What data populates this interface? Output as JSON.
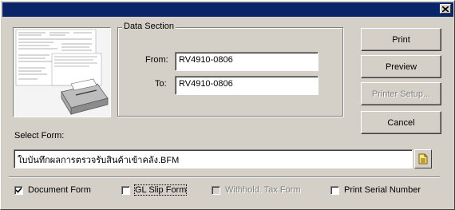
{
  "window": {
    "title": ""
  },
  "data_section": {
    "title": "Data Section",
    "from_label": "From:",
    "from_value": "RV4910-0806",
    "to_label": "To:",
    "to_value": "RV4910-0806"
  },
  "buttons": {
    "print": "Print",
    "preview": "Preview",
    "printer_setup": "Printer Setup...",
    "cancel": "Cancel"
  },
  "select_form": {
    "label": "Select Form:",
    "value": "ใบบันทึกผลการตรวจรับสินค้าเข้าคลัง.BFM"
  },
  "options": [
    {
      "label": "Document Form",
      "checked": true,
      "enabled": true
    },
    {
      "label": "GL Slip Form",
      "checked": false,
      "enabled": true
    },
    {
      "label": "Withhold. Tax Form",
      "checked": false,
      "enabled": false
    },
    {
      "label": "Print Serial Number",
      "checked": false,
      "enabled": true
    }
  ],
  "icons": {
    "close": "close-icon",
    "browse": "folder-icon",
    "preview": "document-preview-thumbnail"
  }
}
